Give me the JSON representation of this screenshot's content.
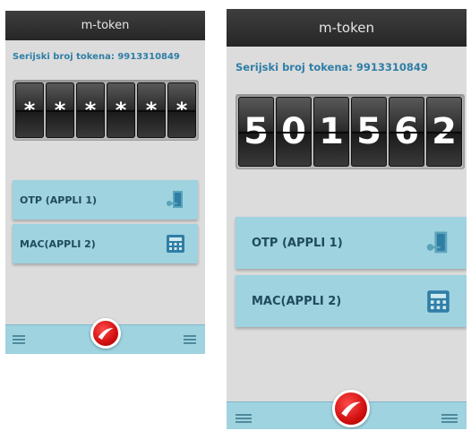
{
  "app": {
    "title": "m-token",
    "serial_label": "Serijski broj tokena: 9913310849"
  },
  "screen_locked": {
    "digits": [
      "*",
      "*",
      "*",
      "*",
      "*",
      "*"
    ]
  },
  "screen_code": {
    "digits": [
      "5",
      "0",
      "1",
      "5",
      "6",
      "2"
    ]
  },
  "menu": {
    "otp_label": "OTP (APPLI 1)",
    "mac_label": "MAC(APPLI 2)"
  },
  "icons": {
    "otp": "door-key-icon",
    "mac": "calculator-icon",
    "menu": "hamburger-icon",
    "logo": "unicredit-logo-icon"
  },
  "colors": {
    "accent": "#9fd3e0",
    "title_bar": "#2e2e2e",
    "serial_text": "#2f7ea6",
    "logo_red": "#d10f0f"
  }
}
